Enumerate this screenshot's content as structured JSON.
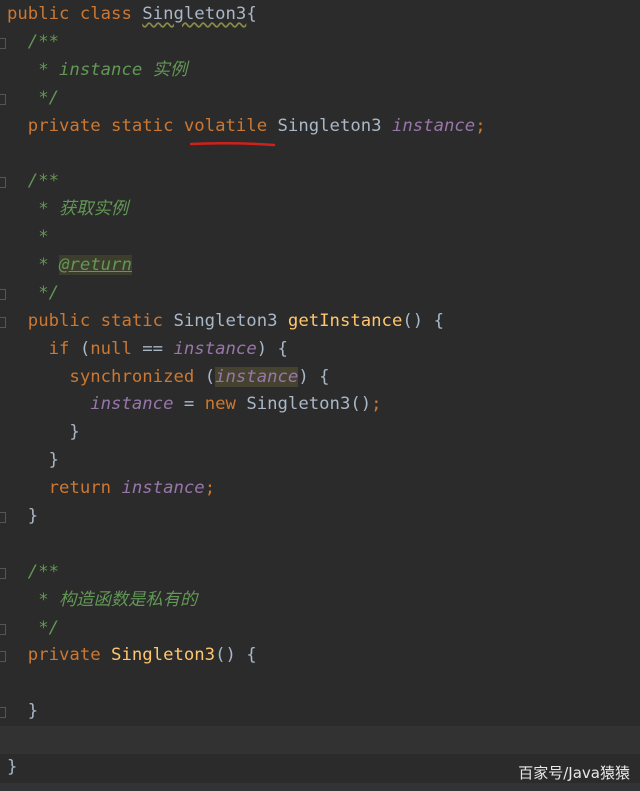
{
  "editor": {
    "language": "java",
    "colors": {
      "background": "#2b2b2b",
      "keyword": "#cc7832",
      "comment": "#629755",
      "field": "#9876aa",
      "method": "#ffc66d",
      "text": "#a9b7c6",
      "annotation_underline": "#d0201c"
    },
    "current_line": 26,
    "lines": [
      [
        [
          "kw",
          "public class "
        ],
        [
          "wavy",
          "Singleton3"
        ],
        [
          "",
          "{"
        ]
      ],
      [
        [
          "cm",
          "  /**"
        ]
      ],
      [
        [
          "cm",
          "   * instance 实例"
        ]
      ],
      [
        [
          "cm",
          "   */"
        ]
      ],
      [
        [
          "kw",
          "  private static "
        ],
        [
          "kw",
          "volatile"
        ],
        [
          "",
          " Singleton3 "
        ],
        [
          "fld",
          "instance"
        ],
        [
          "kw",
          ";"
        ]
      ],
      [],
      [
        [
          "cm",
          "  /**"
        ]
      ],
      [
        [
          "cm",
          "   * 获取实例"
        ]
      ],
      [
        [
          "cm",
          "   *"
        ]
      ],
      [
        [
          "cm",
          "   * "
        ],
        [
          "tag",
          "@return"
        ]
      ],
      [
        [
          "cm",
          "   */"
        ]
      ],
      [
        [
          "kw",
          "  public static "
        ],
        [
          "",
          "Singleton3 "
        ],
        [
          "mth",
          "getInstance"
        ],
        [
          "",
          "() {"
        ]
      ],
      [
        [
          "kw",
          "    if "
        ],
        [
          "",
          "("
        ],
        [
          "kw",
          "null"
        ],
        [
          "",
          " == "
        ],
        [
          "fld",
          "instance"
        ],
        [
          "",
          ") {"
        ]
      ],
      [
        [
          "kw",
          "      synchronized "
        ],
        [
          "",
          "("
        ],
        [
          "fld hl",
          "instance"
        ],
        [
          "",
          ") {"
        ]
      ],
      [
        [
          "fld",
          "        instance"
        ],
        [
          "",
          " = "
        ],
        [
          "kw",
          "new "
        ],
        [
          "",
          "Singleton3()"
        ],
        [
          "kw",
          ";"
        ]
      ],
      [
        [
          "",
          "      }"
        ]
      ],
      [
        [
          "",
          "    }"
        ]
      ],
      [
        [
          "kw",
          "    return "
        ],
        [
          "fld",
          "instance"
        ],
        [
          "kw",
          ";"
        ]
      ],
      [
        [
          "",
          "  }"
        ]
      ],
      [],
      [
        [
          "cm",
          "  /**"
        ]
      ],
      [
        [
          "cm",
          "   * 构造函数是私有的"
        ]
      ],
      [
        [
          "cm",
          "   */"
        ]
      ],
      [
        [
          "kw",
          "  private "
        ],
        [
          "mth",
          "Singleton3"
        ],
        [
          "",
          "() {"
        ]
      ],
      [],
      [
        [
          "",
          "  }"
        ]
      ],
      [],
      [
        [
          "",
          "}"
        ]
      ]
    ]
  },
  "watermark": "百家号/Java猿猿"
}
